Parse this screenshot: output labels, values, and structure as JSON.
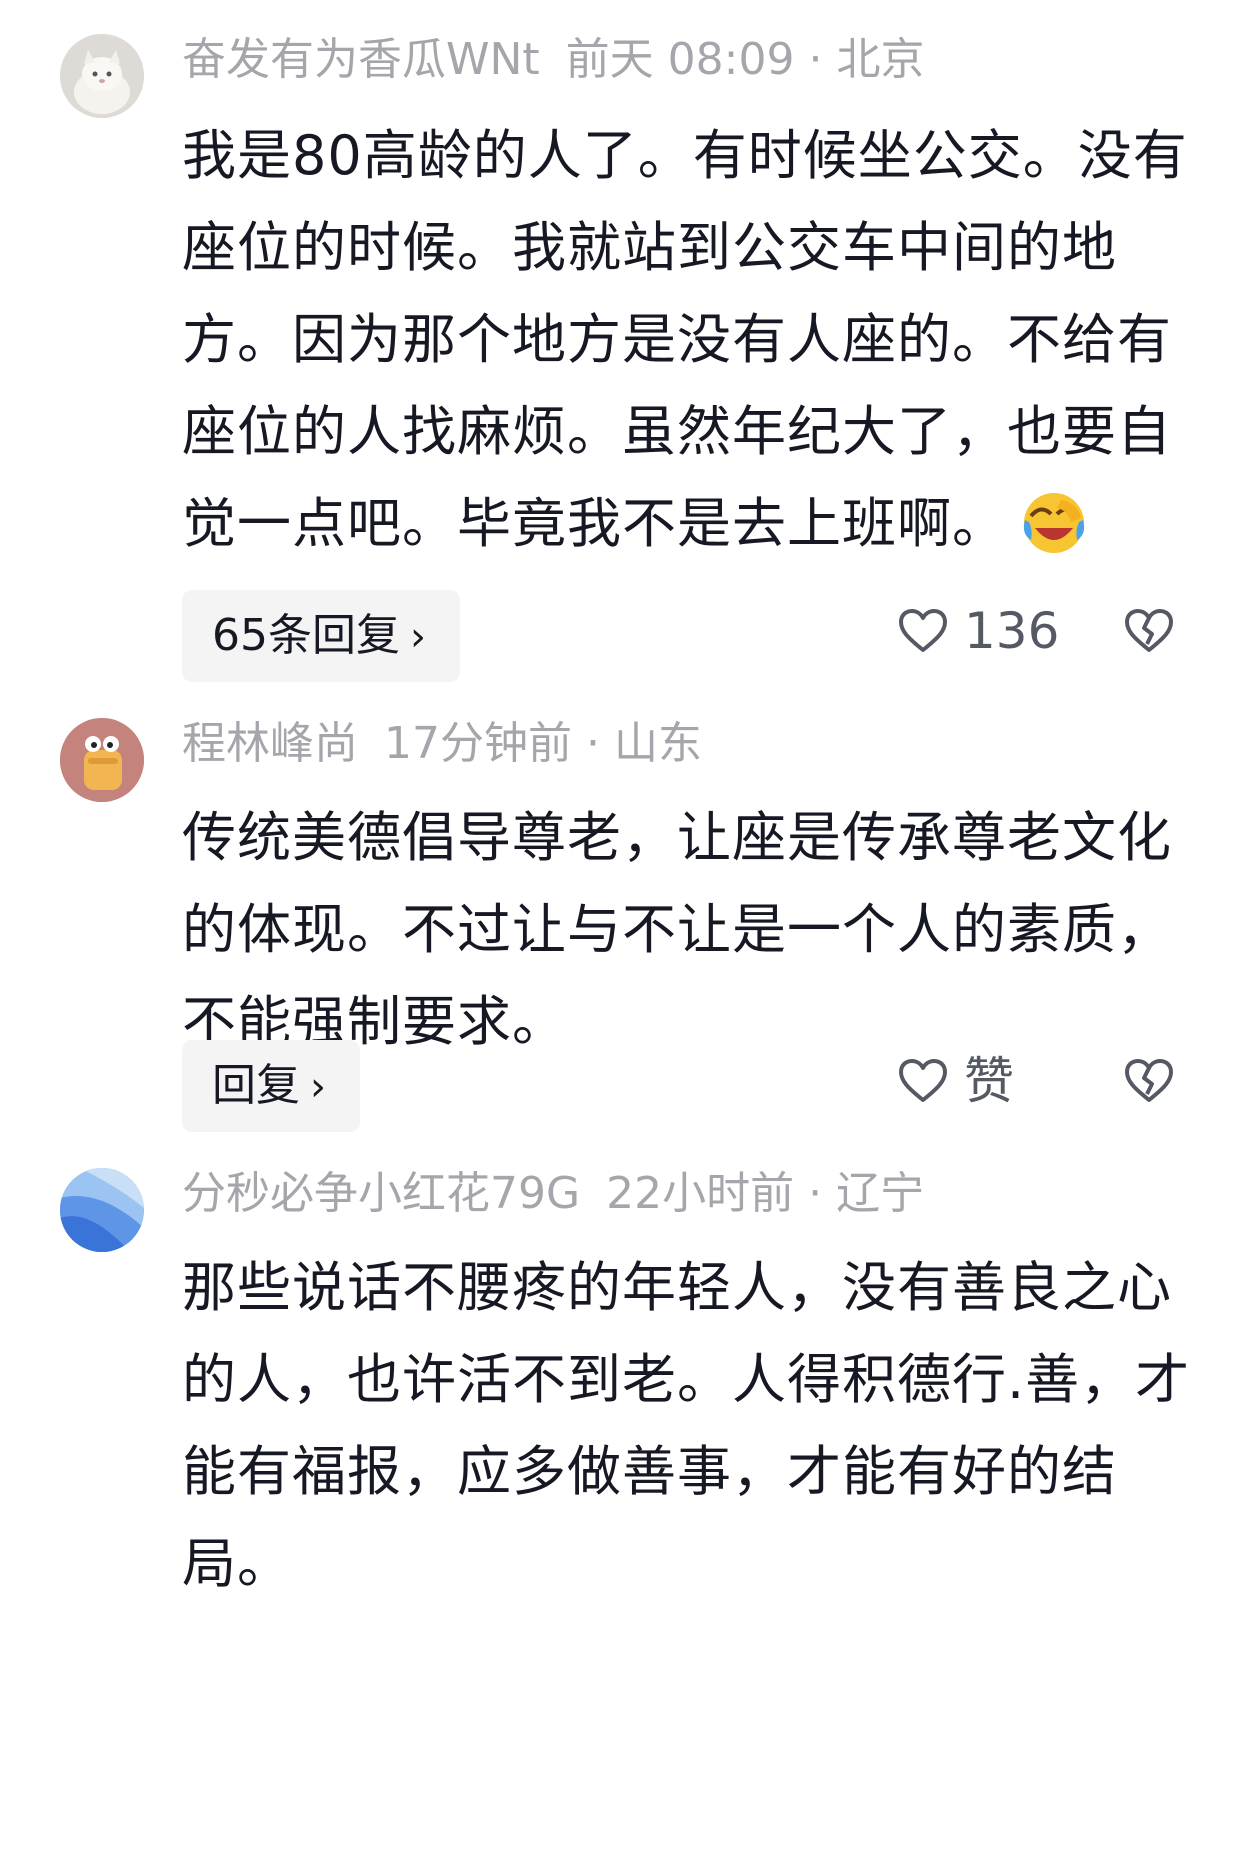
{
  "comments": [
    {
      "username": "奋发有为香瓜WNt",
      "time": "前天 08:09",
      "location": "北京",
      "dot": "·",
      "text": "我是80高龄的人了。有时候坐公交。没有座位的时候。我就站到公交车中间的地方。因为那个地方是没有人座的。不给有座位的人找麻烦。虽然年纪大了，也要自觉一点吧。毕竟我不是去上班啊。",
      "emoji": "laughing-crying-emoji",
      "reply_label": "65条回复",
      "like_count": "136",
      "avatar": "cat-avatar"
    },
    {
      "username": "程林峰尚",
      "time": "17分钟前",
      "location": "山东",
      "dot": "·",
      "text": "传统美德倡导尊老，让座是传承尊老文化的体现。不过让与不让是一个人的素质，不能强制要求。",
      "reply_label": "回复",
      "like_count": "赞",
      "avatar": "cartoon-avatar"
    },
    {
      "username": "分秒必争小红花79G",
      "time": "22小时前",
      "location": "辽宁",
      "dot": "·",
      "text": "那些说话不腰疼的年轻人，没有善良之心的人，也许活不到老。人得积德行.善，才能有福报，应多做善事，才能有好的结局。",
      "avatar": "blue-abstract-avatar"
    }
  ],
  "icons": {
    "chevron": "›",
    "like": "heart-outline-icon",
    "dislike": "broken-heart-icon"
  },
  "colors": {
    "text": "#161823",
    "meta": "#a4a6ab",
    "button_bg": "#f4f4f5",
    "icon": "#555963"
  }
}
